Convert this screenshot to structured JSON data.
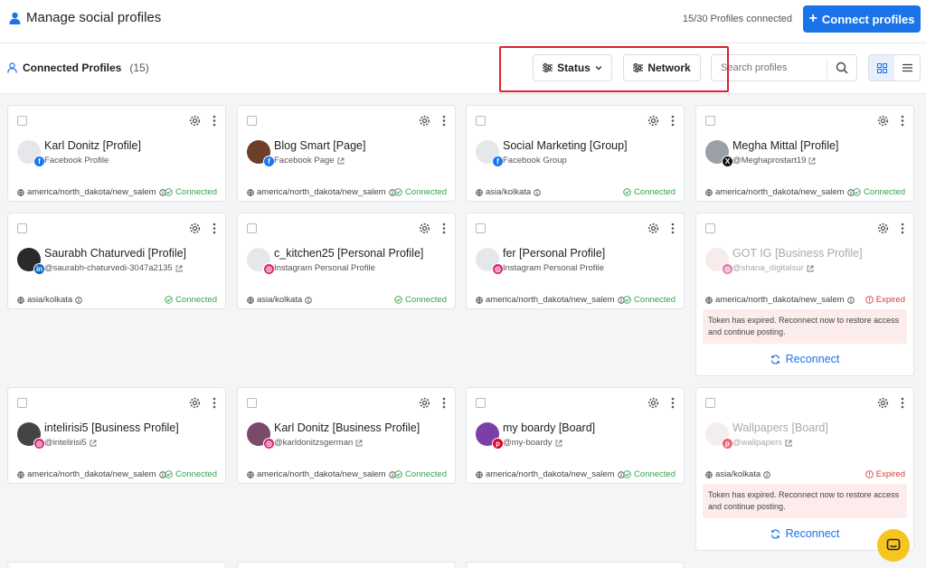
{
  "header": {
    "title": "Manage social profiles",
    "profiles_connected": "15/30 Profiles connected",
    "connect_button": "Connect profiles"
  },
  "toolbar": {
    "section_title": "Connected Profiles",
    "section_count": "(15)",
    "status_filter": "Status",
    "network_filter": "Network",
    "search_placeholder": "Search profiles"
  },
  "profiles": [
    {
      "name": "Karl Donitz [Profile]",
      "sub": "Facebook Profile",
      "network": "facebook",
      "timezone": "america/north_dakota/new_salem",
      "status": "Connected"
    },
    {
      "name": "Blog Smart [Page]",
      "sub": "Facebook Page",
      "network": "facebook",
      "timezone": "america/north_dakota/new_salem",
      "status": "Connected"
    },
    {
      "name": "Social Marketing [Group]",
      "sub": "Facebook Group",
      "network": "facebook",
      "timezone": "asia/kolkata",
      "status": "Connected"
    },
    {
      "name": "Megha Mittal [Profile]",
      "sub": "@Meghaprostart19",
      "network": "x",
      "timezone": "america/north_dakota/new_salem",
      "status": "Connected"
    },
    {
      "name": "Saurabh Chaturvedi [Profile]",
      "sub": "@saurabh-chaturvedi-3047a2135",
      "network": "linkedin",
      "timezone": "asia/kolkata",
      "status": "Connected"
    },
    {
      "name": "c_kitchen25 [Personal Profile]",
      "sub": "Instagram Personal Profile",
      "network": "instagram",
      "timezone": "asia/kolkata",
      "status": "Connected"
    },
    {
      "name": "fer [Personal Profile]",
      "sub": "Instagram Personal Profile",
      "network": "instagram",
      "timezone": "america/north_dakota/new_salem",
      "status": "Connected"
    },
    {
      "name": "GOT IG [Business Profile]",
      "sub": "@shana_digitalsur",
      "network": "instagram",
      "timezone": "america/north_dakota/new_salem",
      "status": "Expired",
      "token_message": "Token has expired. Reconnect now to restore access and continue posting.",
      "reconnect_label": "Reconnect"
    },
    {
      "name": "intelirisi5 [Business Profile]",
      "sub": "@intelirisi5",
      "network": "instagram",
      "timezone": "america/north_dakota/new_salem",
      "status": "Connected"
    },
    {
      "name": "Karl Donitz [Business Profile]",
      "sub": "@karldonitzsgerman",
      "network": "instagram",
      "timezone": "america/north_dakota/new_salem",
      "status": "Connected"
    },
    {
      "name": "my boardy [Board]",
      "sub": "@my-boardy",
      "network": "pinterest",
      "timezone": "america/north_dakota/new_salem",
      "status": "Connected"
    },
    {
      "name": "Wallpapers [Board]",
      "sub": "@wallpapers",
      "network": "pinterest",
      "timezone": "asia/kolkata",
      "status": "Expired",
      "token_message": "Token has expired. Reconnect now to restore access and continue posting.",
      "reconnect_label": "Reconnect"
    }
  ],
  "colors": {
    "primary": "#1a73e8",
    "connected": "#33a34f",
    "expired": "#d83b3b",
    "highlight": "#e2202f",
    "chat": "#f7c51f"
  }
}
